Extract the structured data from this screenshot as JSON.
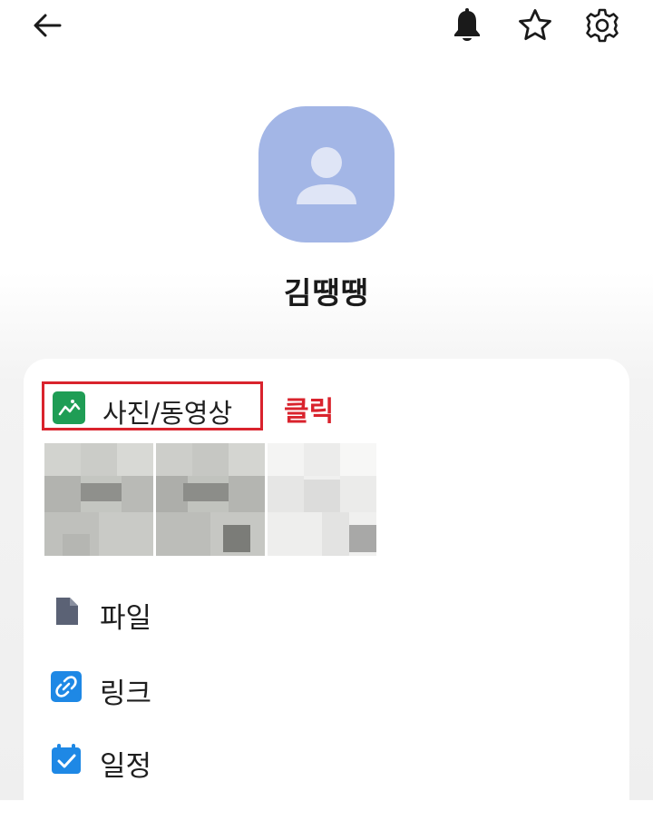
{
  "header": {
    "back_icon": "arrow-left-icon",
    "bell_icon": "bell-icon",
    "star_icon": "star-outline-icon",
    "settings_icon": "gear-icon"
  },
  "profile": {
    "name": "김땡땡",
    "avatar_icon": "person-silhouette-icon",
    "avatar_color": "#a3b6e6"
  },
  "sections": {
    "photos": {
      "label": "사진/동영상",
      "icon": "photo-gallery-icon",
      "icon_color": "#1f9d55"
    },
    "annotation": {
      "text": "클릭",
      "color": "#d9232d"
    },
    "thumbnails": [
      {
        "name": "thumbnail-1"
      },
      {
        "name": "thumbnail-2"
      },
      {
        "name": "thumbnail-3"
      }
    ],
    "files": {
      "label": "파일",
      "icon": "file-icon",
      "icon_color": "#5b6275"
    },
    "links": {
      "label": "링크",
      "icon": "link-icon",
      "icon_color": "#1e88e5"
    },
    "events": {
      "label": "일정",
      "icon": "calendar-check-icon",
      "icon_color": "#1e88e5"
    }
  }
}
